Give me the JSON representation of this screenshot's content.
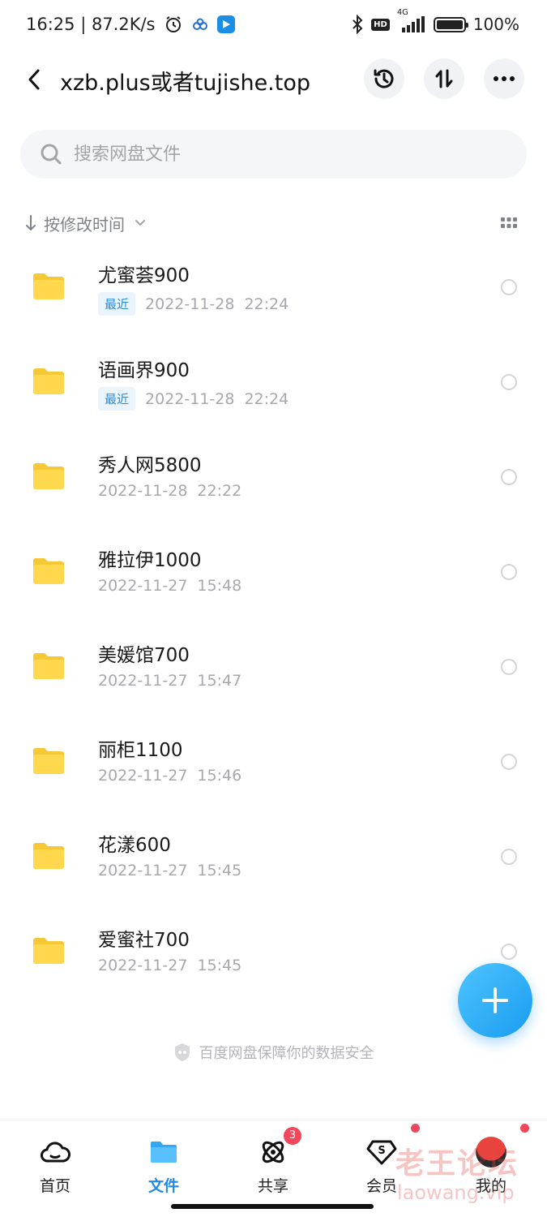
{
  "status_bar": {
    "left_text": "16:25 | 87.2K/s",
    "network": "4G",
    "hd": "HD",
    "battery": "100%",
    "battery_level": 1.0
  },
  "header": {
    "title": "xzb.plus或者tujishe.top",
    "back_icon": "chevron-left-icon",
    "history_icon": "history-icon",
    "transfer_icon": "transfer-icon",
    "more_icon": "more-icon"
  },
  "search": {
    "placeholder": "搜索网盘文件"
  },
  "sort": {
    "label": "按修改时间"
  },
  "files": [
    {
      "name": "尤蜜荟900",
      "tag": "最近",
      "date": "2022-11-28",
      "time": "22:24"
    },
    {
      "name": "语画界900",
      "tag": "最近",
      "date": "2022-11-28",
      "time": "22:24"
    },
    {
      "name": "秀人网5800",
      "tag": "",
      "date": "2022-11-28",
      "time": "22:22"
    },
    {
      "name": "雅拉伊1000",
      "tag": "",
      "date": "2022-11-27",
      "time": "15:48"
    },
    {
      "name": "美媛馆700",
      "tag": "",
      "date": "2022-11-27",
      "time": "15:47"
    },
    {
      "name": "丽柜1100",
      "tag": "",
      "date": "2022-11-27",
      "time": "15:46"
    },
    {
      "name": "花漾600",
      "tag": "",
      "date": "2022-11-27",
      "time": "15:45"
    },
    {
      "name": "爱蜜社700",
      "tag": "",
      "date": "2022-11-27",
      "time": "15:45"
    }
  ],
  "security_note": "百度网盘保障你的数据安全",
  "nav": {
    "home": "首页",
    "files": "文件",
    "share": "共享",
    "share_badge": "3",
    "vip": "会员",
    "me": "我的"
  },
  "watermark": {
    "main": "老王论坛",
    "sub": "laowang.vip"
  },
  "colors": {
    "accent": "#1d8bea",
    "folder": "#ffd84d",
    "badge": "#f2465b"
  }
}
